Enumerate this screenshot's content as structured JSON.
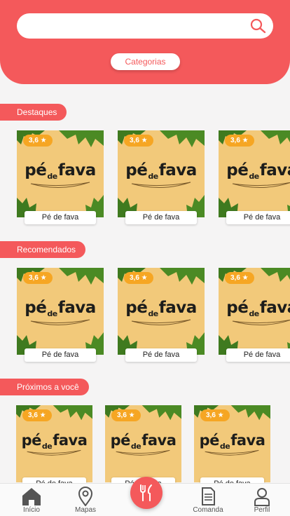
{
  "search": {
    "placeholder": ""
  },
  "categories_button": "Categorias",
  "sections": [
    {
      "title": "Destaques",
      "items": [
        {
          "rating": "3,6 ★",
          "name": "Pé de fava"
        },
        {
          "rating": "3,6 ★",
          "name": "Pé de fava"
        },
        {
          "rating": "3,6 ★",
          "name": "Pé de fava"
        }
      ]
    },
    {
      "title": "Recomendados",
      "items": [
        {
          "rating": "3,6 ★",
          "name": "Pé de fava"
        },
        {
          "rating": "3,6 ★",
          "name": "Pé de fava"
        },
        {
          "rating": "3,6 ★",
          "name": "Pé de fava"
        }
      ]
    },
    {
      "title": "Próximos a você",
      "items": [
        {
          "rating": "3,6 ★",
          "name": "Pé de fava"
        },
        {
          "rating": "3,6 ★",
          "name": "Pé de fava"
        },
        {
          "rating": "3,6 ★",
          "name": "Pé de fava"
        }
      ]
    }
  ],
  "logo": {
    "pe": "pé",
    "de": "de",
    "fava": "fava"
  },
  "nav": {
    "inicio": "Início",
    "mapas": "Mapas",
    "comanda": "Comanda",
    "perfil": "Perfil"
  },
  "colors": {
    "accent": "#f4595b",
    "rating": "#f6a623",
    "card": "#f2c97a"
  },
  "icons": {
    "search": "search-icon",
    "home": "home-icon",
    "map": "map-pin-icon",
    "restaurant": "fork-knife-icon",
    "comanda": "document-icon",
    "profile": "user-icon"
  }
}
